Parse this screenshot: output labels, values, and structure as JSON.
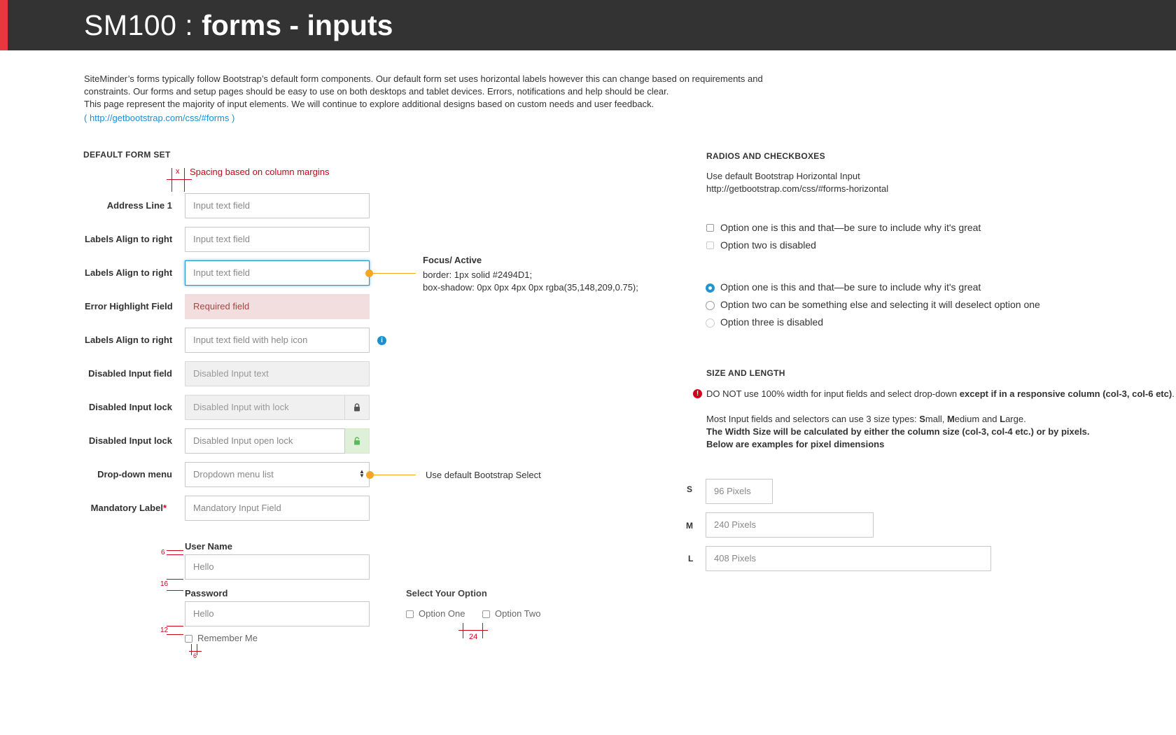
{
  "header": {
    "title_prefix": "SM100 : ",
    "title_main": "forms - inputs"
  },
  "intro": {
    "line1": "SiteMinder’s forms typically follow Bootstrap’s default form components. Our default form set uses horizontal labels however this can change based on requirements and",
    "line2": "constraints. Our forms and setup pages should be easy to use on both desktops and tablet devices. Errors, notifications and help should be clear.",
    "line3": "This page represent the majority of input elements. We will continue to explore additional designs based on custom needs and user feedback.",
    "link": "( http://getbootstrap.com/css/#forms )"
  },
  "default_form": {
    "heading": "DEFAULT FORM SET",
    "spacing_x": "x",
    "spacing_note": "Spacing based on column margins",
    "rows": [
      {
        "label": "Address Line 1",
        "placeholder": "Input text field"
      },
      {
        "label": "Labels Align to right",
        "placeholder": "Input text field"
      },
      {
        "label": "Labels Align to right",
        "placeholder": "Input text field"
      },
      {
        "label": "Error Highlight Field",
        "placeholder": "Required field"
      },
      {
        "label": "Labels Align to right",
        "placeholder": "Input text field with help icon"
      },
      {
        "label": "Disabled Input field",
        "placeholder": "Disabled Input text"
      },
      {
        "label": "Disabled Input lock",
        "placeholder": "Disabled Input with lock"
      },
      {
        "label": "Disabled Input lock",
        "placeholder": "Disabled Input open lock"
      },
      {
        "label": "Drop-down menu",
        "placeholder": "Dropdown menu list"
      },
      {
        "label": "Mandatory Label",
        "placeholder": "Mandatory Input Field",
        "required_mark": "*"
      }
    ],
    "focus_note": {
      "title": "Focus/ Active",
      "line1": "border: 1px solid #2494D1;",
      "line2": "box-shadow: 0px 0px 4px 0px rgba(35,148,209,0.75);"
    },
    "select_note": "Use default Bootstrap Select",
    "help_icon": "info-icon",
    "lock_icon": "lock-icon",
    "unlock_icon": "unlock-icon"
  },
  "login_form": {
    "username_label": "User Name",
    "username_value": "Hello",
    "password_label": "Password",
    "password_value": "Hello",
    "remember_label": "Remember Me",
    "spacing_6a": "6",
    "spacing_16": "16",
    "spacing_12": "12",
    "spacing_6b": "6"
  },
  "select_option": {
    "heading": "Select Your Option",
    "option_one": "Option One",
    "option_two": "Option Two",
    "spacing_24": "24"
  },
  "radios_checkboxes": {
    "heading": "RADIOS AND CHECKBOXES",
    "desc": "Use default Bootstrap Horizontal Input",
    "link": "http://getbootstrap.com/css/#forms-horizontal",
    "checkbox_one": "Option one is this and that—be sure to include why it's great",
    "checkbox_two": "Option two is disabled",
    "radio_one": "Option one is this and that—be sure to include why it's great",
    "radio_two": "Option two can be something else and selecting it will deselect option one",
    "radio_three": "Option three is disabled"
  },
  "size_length": {
    "heading": "SIZE AND LENGTH",
    "warning_icon": "alert-icon",
    "warn_pre": "DO NOT use 100% width for input fields and select drop-down ",
    "warn_bold": "except if in a responsive column (col-3, col-6 etc)",
    "warn_post": ".",
    "types_pre": "Most Input fields and selectors can use 3 size types: ",
    "types_s": "S",
    "types_s_rest": "mall, ",
    "types_m": "M",
    "types_m_rest": "edium and ",
    "types_l": "L",
    "types_l_rest": "arge.",
    "bold_line1": "The Width Size will be calculated by either the column size (col-3, col-4 etc.) or by pixels.",
    "bold_line2": "Below are examples for pixel dimensions",
    "sizes": [
      {
        "label": "S",
        "placeholder": "96 Pixels"
      },
      {
        "label": "M",
        "placeholder": "240 Pixels"
      },
      {
        "label": "L",
        "placeholder": "408 Pixels"
      }
    ]
  },
  "colors": {
    "header_bg": "#333333",
    "accent": "#e8383d",
    "focus": "#2494D1",
    "annotation": "#f5a623",
    "spec_red": "#d0021b"
  }
}
